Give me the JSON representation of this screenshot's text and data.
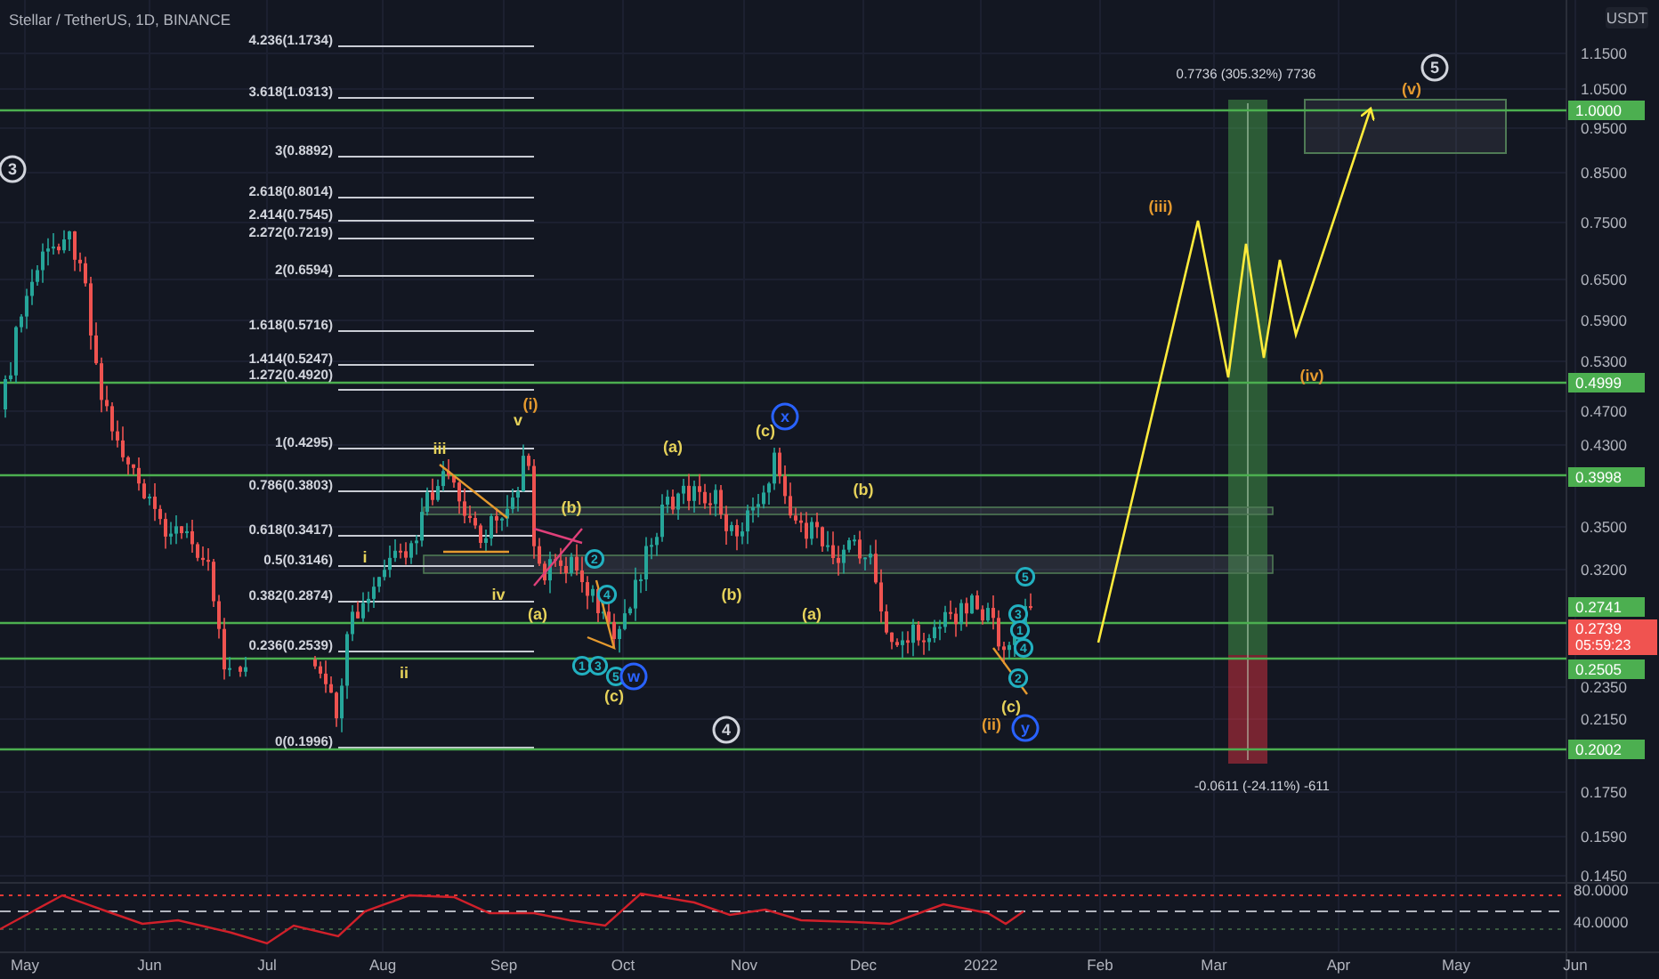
{
  "title": "Stellar / TetherUS, 1D, BINANCE",
  "currency": "USDT",
  "price_axis": [
    "1.1500",
    "1.0500",
    "0.9500",
    "0.8500",
    "0.7500",
    "0.6500",
    "0.5900",
    "0.5300",
    "0.4700",
    "0.4300",
    "0.3500",
    "0.3200",
    "0.2350",
    "0.2150",
    "0.1750",
    "0.1590",
    "0.1450"
  ],
  "indicator_axis": [
    "80.0000",
    "40.0000"
  ],
  "time_axis": [
    "May",
    "Jun",
    "Jul",
    "Aug",
    "Sep",
    "Oct",
    "Nov",
    "Dec",
    "2022",
    "Feb",
    "Mar",
    "Apr",
    "May",
    "Jun"
  ],
  "price_tags": [
    {
      "text": "1.0000",
      "kind": "level",
      "color": "#4caf50"
    },
    {
      "text": "0.4999",
      "kind": "level",
      "color": "#4caf50"
    },
    {
      "text": "0.3998",
      "kind": "level",
      "color": "#4caf50"
    },
    {
      "text": "0.2741",
      "kind": "level",
      "color": "#4caf50"
    },
    {
      "text": "0.2739",
      "countdown": "05:59:23",
      "kind": "last",
      "color": "#f05350"
    },
    {
      "text": "0.2505",
      "kind": "level",
      "color": "#4caf50"
    },
    {
      "text": "0.2002",
      "kind": "level",
      "color": "#4caf50"
    }
  ],
  "fib_levels": [
    "4.236(1.1734)",
    "3.618(1.0313)",
    "3(0.8892)",
    "2.618(0.8014)",
    "2.414(0.7545)",
    "2.272(0.7219)",
    "2(0.6594)",
    "1.618(0.5716)",
    "1.414(0.5247)",
    "1.272(0.4920)",
    "1(0.4295)",
    "0.786(0.3803)",
    "0.618(0.3417)",
    "0.5(0.3146)",
    "0.382(0.2874)",
    "0.236(0.2539)",
    "0(0.1996)"
  ],
  "wave_labels": [
    {
      "text": "5",
      "kind": "circled",
      "color": "#d1d4dc"
    },
    {
      "text": "(v)",
      "kind": "plain",
      "color": "#e59a2f"
    },
    {
      "text": "3",
      "kind": "circled",
      "color": "#d1d4dc"
    },
    {
      "text": "(iii)",
      "kind": "plain",
      "color": "#e59a2f"
    },
    {
      "text": "(iv)",
      "kind": "plain",
      "color": "#e59a2f"
    },
    {
      "text": "(i)",
      "kind": "plain",
      "color": "#e59a2f"
    },
    {
      "text": "v",
      "kind": "plain",
      "color": "#e6d25a"
    },
    {
      "text": "(c)",
      "kind": "plain",
      "color": "#e6d25a"
    },
    {
      "text": "x",
      "kind": "circled",
      "color": "#2962ff"
    },
    {
      "text": "iii",
      "kind": "plain",
      "color": "#e6d25a"
    },
    {
      "text": "(a)",
      "kind": "plain",
      "color": "#e6d25a"
    },
    {
      "text": "(b)",
      "kind": "plain",
      "color": "#e6d25a"
    },
    {
      "text": "(b)",
      "kind": "plain",
      "color": "#e6d25a"
    },
    {
      "text": "i",
      "kind": "plain",
      "color": "#e6d25a"
    },
    {
      "text": "2",
      "kind": "small",
      "color": "#22b0c0"
    },
    {
      "text": "5",
      "kind": "small",
      "color": "#22b0c0"
    },
    {
      "text": "iv",
      "kind": "plain",
      "color": "#e6d25a"
    },
    {
      "text": "4",
      "kind": "small",
      "color": "#22b0c0"
    },
    {
      "text": "(b)",
      "kind": "plain",
      "color": "#e6d25a"
    },
    {
      "text": "(a)",
      "kind": "plain",
      "color": "#e6d25a"
    },
    {
      "text": "(a)",
      "kind": "plain",
      "color": "#e6d25a"
    },
    {
      "text": "3",
      "kind": "small",
      "color": "#22b0c0"
    },
    {
      "text": "1",
      "kind": "small",
      "color": "#22b0c0"
    },
    {
      "text": "4",
      "kind": "small",
      "color": "#22b0c0"
    },
    {
      "text": "ii",
      "kind": "plain",
      "color": "#e6d25a"
    },
    {
      "text": "1",
      "kind": "small",
      "color": "#22b0c0"
    },
    {
      "text": "3",
      "kind": "small",
      "color": "#22b0c0"
    },
    {
      "text": "5",
      "kind": "small",
      "color": "#22b0c0"
    },
    {
      "text": "w",
      "kind": "circled",
      "color": "#2962ff"
    },
    {
      "text": "2",
      "kind": "small",
      "color": "#22b0c0"
    },
    {
      "text": "(c)",
      "kind": "plain",
      "color": "#e6d25a"
    },
    {
      "text": "(c)",
      "kind": "plain",
      "color": "#e6d25a"
    },
    {
      "text": "4",
      "kind": "circled",
      "color": "#d1d4dc"
    },
    {
      "text": "(ii)",
      "kind": "plain",
      "color": "#e59a2f"
    },
    {
      "text": "y",
      "kind": "circled",
      "color": "#2962ff"
    }
  ],
  "position_tool": {
    "target": "0.7736 (305.32%) 7736",
    "stop": "-0.0611 (-24.11%) -611"
  }
}
